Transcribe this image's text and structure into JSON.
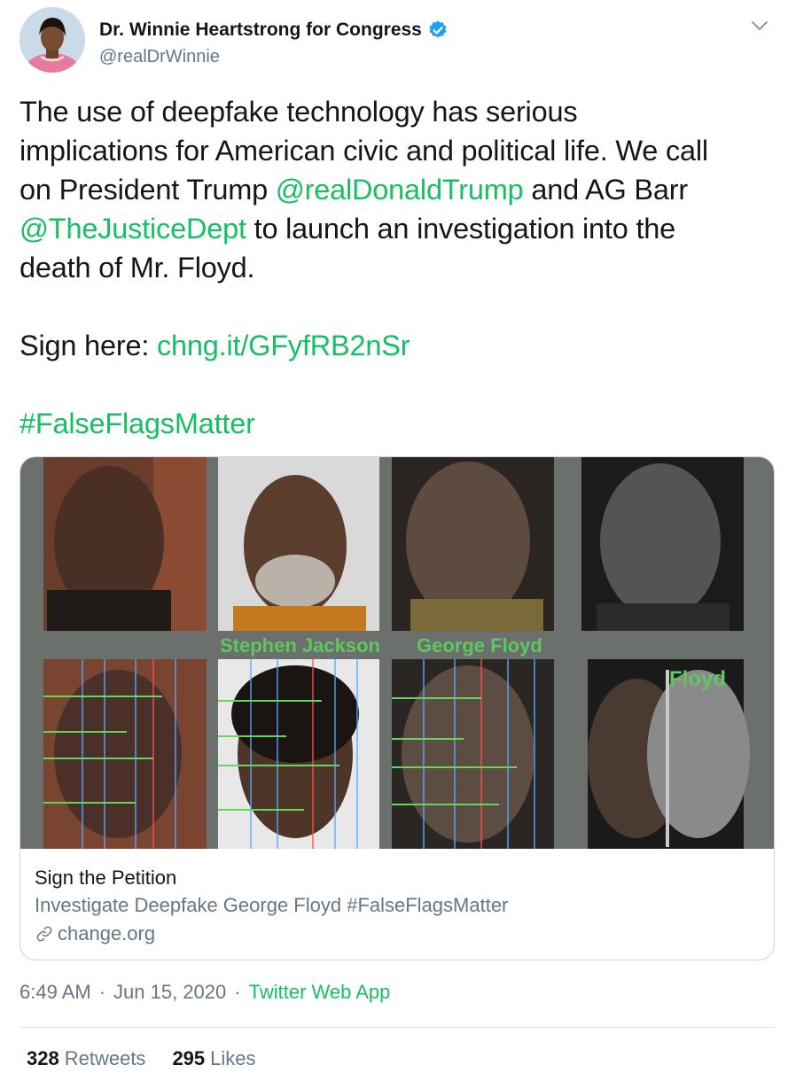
{
  "author": {
    "display_name": "Dr. Winnie Heartstrong for Congress",
    "handle": "@realDrWinnie",
    "verified": true,
    "avatar_icon": "profile-photo"
  },
  "tweet": {
    "lines": [
      [
        {
          "t": "The use of deepfake technology has serious"
        }
      ],
      [
        {
          "t": "implications for American civic and political life. We call"
        }
      ],
      [
        {
          "t": "on President Trump "
        },
        {
          "t": "@realDonaldTrump",
          "link": true
        },
        {
          "t": " and AG Barr"
        }
      ],
      [
        {
          "t": "@TheJusticeDept",
          "link": true
        },
        {
          "t": " to launch an investigation into the"
        }
      ],
      [
        {
          "t": "death of Mr. Floyd."
        }
      ],
      [],
      [
        {
          "t": "Sign here: "
        },
        {
          "t": "chng.it/GFyfRB2nSr",
          "link": true
        }
      ],
      [],
      [
        {
          "t": "#FalseFlagsMatter",
          "link": true
        }
      ]
    ]
  },
  "card": {
    "image_labels": {
      "stephen": "Stephen Jackson",
      "george": "George Floyd",
      "floyd": "Floyd"
    },
    "title": "Sign the Petition",
    "description": "Investigate Deepfake George Floyd #FalseFlagsMatter",
    "domain": "change.org"
  },
  "meta": {
    "time": "6:49 AM",
    "separator": "·",
    "date": "Jun 15, 2020",
    "source": "Twitter Web App"
  },
  "stats": {
    "retweets_count": "328",
    "retweets_label": "Retweets",
    "likes_count": "295",
    "likes_label": "Likes"
  },
  "colors": {
    "link": "#17bf63",
    "secondary_text": "#657786",
    "verified_badge": "#1da1f2"
  }
}
